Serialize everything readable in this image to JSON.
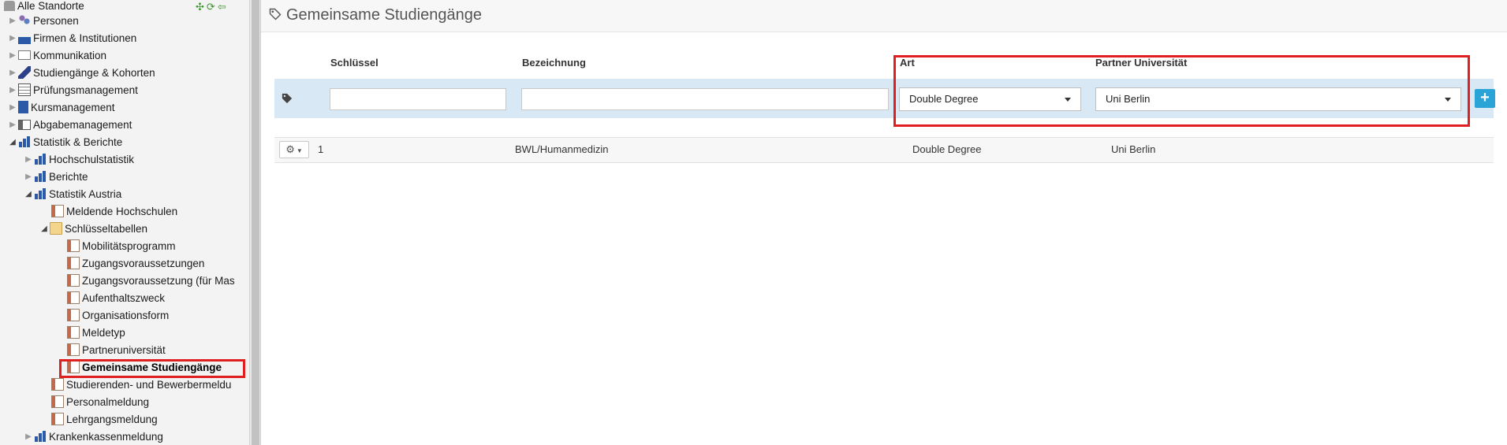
{
  "sidebar": {
    "root_label": "Alle Standorte",
    "items": [
      {
        "label": "Personen"
      },
      {
        "label": "Firmen & Institutionen"
      },
      {
        "label": "Kommunikation"
      },
      {
        "label": "Studiengänge & Kohorten"
      },
      {
        "label": "Prüfungsmanagement"
      },
      {
        "label": "Kursmanagement"
      },
      {
        "label": "Abgabemanagement"
      },
      {
        "label": "Statistik & Berichte"
      },
      {
        "label": "Hochschulstatistik"
      },
      {
        "label": "Berichte"
      },
      {
        "label": "Statistik Austria"
      },
      {
        "label": "Meldende Hochschulen"
      },
      {
        "label": "Schlüsseltabellen"
      },
      {
        "label": "Mobilitätsprogramm"
      },
      {
        "label": "Zugangsvoraussetzungen"
      },
      {
        "label": "Zugangsvoraussetzung (für Mas"
      },
      {
        "label": "Aufenthaltszweck"
      },
      {
        "label": "Organisationsform"
      },
      {
        "label": "Meldetyp"
      },
      {
        "label": "Partneruniversität"
      },
      {
        "label": "Gemeinsame Studiengänge"
      },
      {
        "label": "Studierenden- und Bewerbermeldu"
      },
      {
        "label": "Personalmeldung"
      },
      {
        "label": "Lehrgangsmeldung"
      },
      {
        "label": "Krankenkassenmeldung"
      }
    ]
  },
  "main": {
    "title": "Gemeinsame Studiengänge",
    "columns": [
      "Schlüssel",
      "Bezeichnung",
      "Art",
      "Partner Universität"
    ],
    "filter": {
      "schluessel_value": "",
      "bezeichnung_value": "",
      "art_selected": "Double Degree",
      "partner_selected": "Uni Berlin",
      "add_label": "+"
    },
    "rows": [
      {
        "schluessel": "1",
        "bezeichnung": "BWL/Humanmedizin",
        "art": "Double Degree",
        "partner": "Uni Berlin"
      }
    ]
  },
  "colors": {
    "filter_row_bg": "#d8e9f5",
    "add_button": "#2aa3d6",
    "highlight_border": "#e02020",
    "bar_icon": "#2c5aa8"
  }
}
